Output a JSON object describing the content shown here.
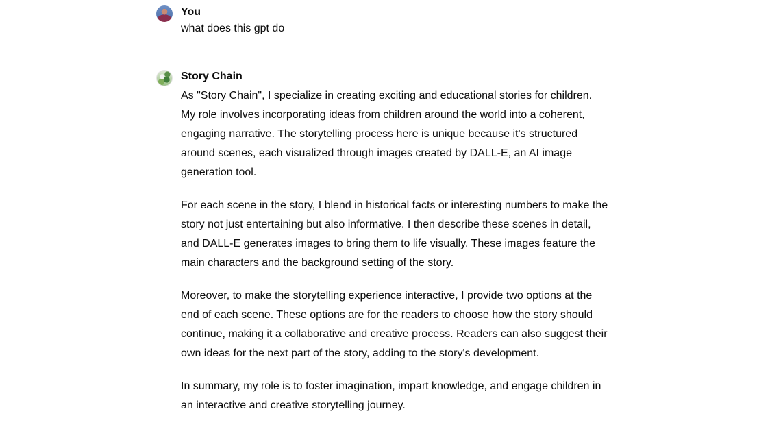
{
  "conversation": {
    "user_message": {
      "author": "You",
      "text": "what does this gpt do"
    },
    "assistant_message": {
      "author": "Story Chain",
      "paragraphs": [
        "As \"Story Chain\", I specialize in creating exciting and educational stories for children. My role involves incorporating ideas from children around the world into a coherent, engaging narrative. The storytelling process here is unique because it's structured around scenes, each visualized through images created by DALL-E, an AI image generation tool.",
        "For each scene in the story, I blend in historical facts or interesting numbers to make the story not just entertaining but also informative. I then describe these scenes in detail, and DALL-E generates images to bring them to life visually. These images feature the main characters and the background setting of the story.",
        "Moreover, to make the storytelling experience interactive, I provide two options at the end of each scene. These options are for the readers to choose how the story should continue, making it a collaborative and creative process. Readers can also suggest their own ideas for the next part of the story, adding to the story's development.",
        "In summary, my role is to foster imagination, impart knowledge, and engage children in an interactive and creative storytelling journey."
      ]
    }
  }
}
